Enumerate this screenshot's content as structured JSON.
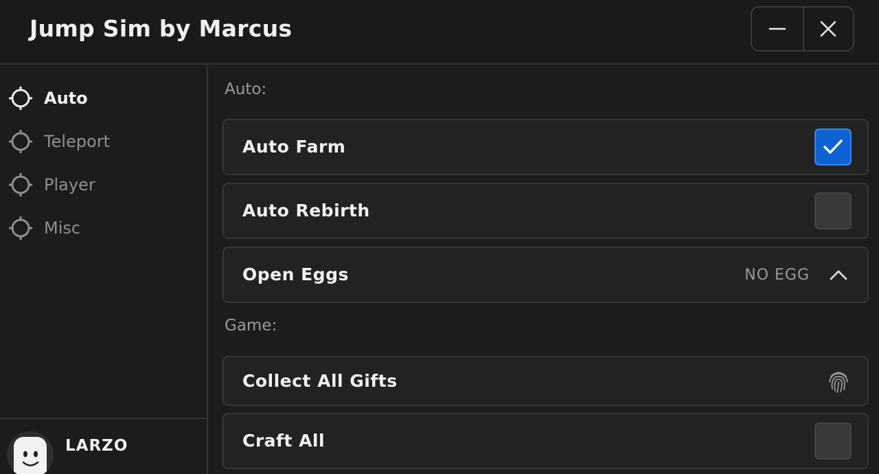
{
  "window": {
    "title": "Jump Sim by Marcus",
    "minimize_icon": "minimize-icon",
    "close_icon": "close-icon"
  },
  "sidebar": {
    "items": [
      {
        "label": "Auto",
        "icon": "crosshair-icon",
        "active": true
      },
      {
        "label": "Teleport",
        "icon": "crosshair-icon",
        "active": false
      },
      {
        "label": "Player",
        "icon": "crosshair-icon",
        "active": false
      },
      {
        "label": "Misc",
        "icon": "crosshair-icon",
        "active": false
      }
    ],
    "user": {
      "name": "LARZO",
      "avatar_icon": "smiley-avatar-icon"
    }
  },
  "main": {
    "sections": [
      {
        "title": "Auto:"
      },
      {
        "title": "Game:"
      }
    ],
    "rows": [
      {
        "label": "Auto Farm",
        "control": "checkbox",
        "checked": true
      },
      {
        "label": "Auto Rebirth",
        "control": "checkbox",
        "checked": false
      },
      {
        "label": "Open Eggs",
        "control": "dropdown",
        "value": "NO EGG",
        "icon": "chevron-up-icon"
      },
      {
        "label": "Collect All Gifts",
        "control": "button",
        "icon": "fingerprint-icon"
      },
      {
        "label": "Craft All",
        "control": "checkbox",
        "checked": false
      }
    ]
  },
  "colors": {
    "background": "#1c1c1c",
    "row_background": "#222222",
    "accent_checked": "#0f62d6",
    "text_primary": "#f0f0f0",
    "text_muted": "#9a9a9a"
  }
}
